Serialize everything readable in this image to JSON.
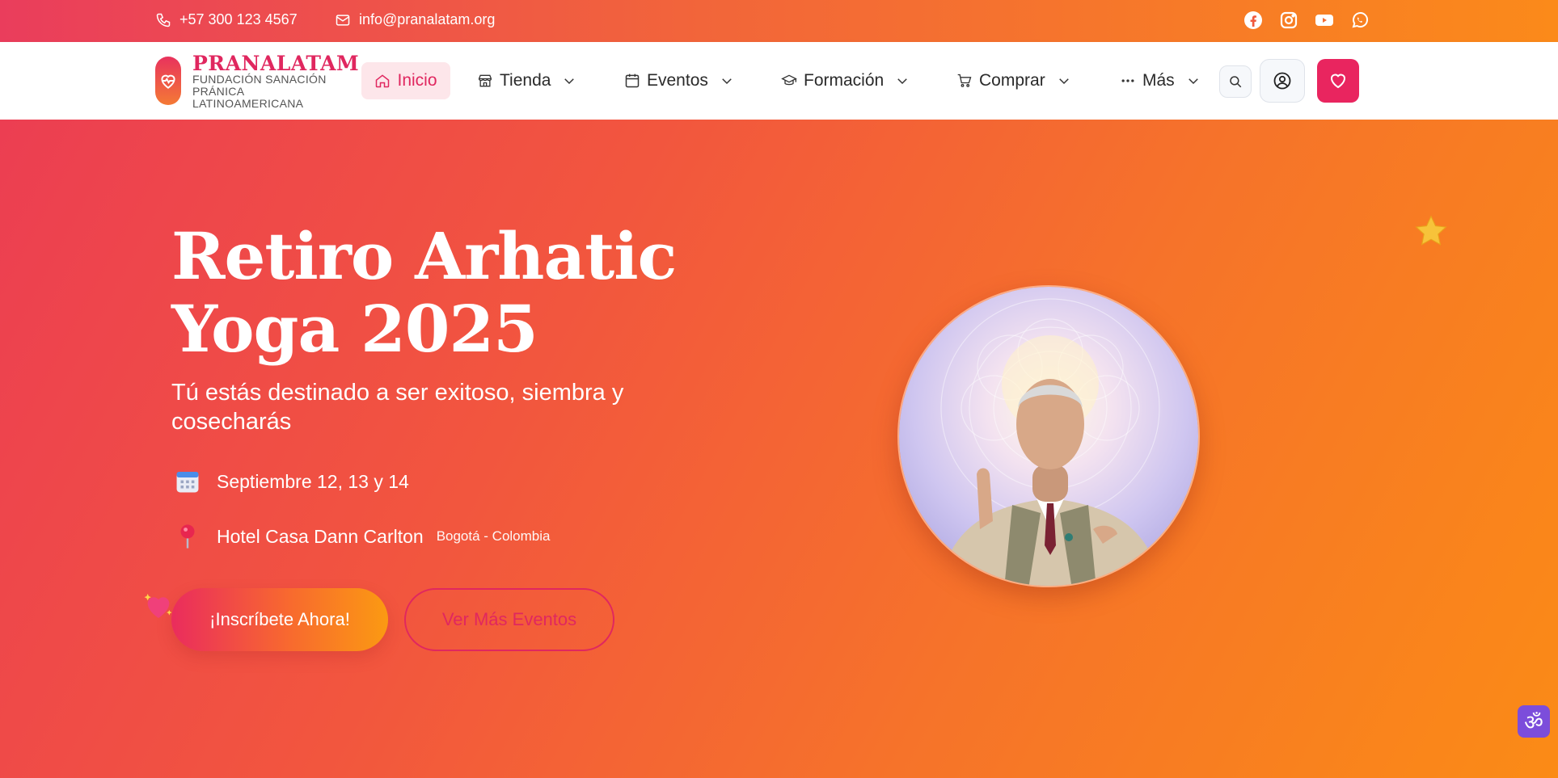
{
  "topbar": {
    "phone": "+57 300 123 4567",
    "email": "info@pranalatam.org",
    "socials": [
      "facebook-icon",
      "instagram-icon",
      "youtube-icon",
      "whatsapp-icon"
    ]
  },
  "brand": {
    "name": "PRANALATAM",
    "subtitle": "FUNDACIÓN SANACIÓN PRÁNICA LATINOAMERICANA",
    "primary_color": "#e0275f",
    "accent_color": "#fb8a1a"
  },
  "nav": {
    "items": [
      {
        "label": "Inicio",
        "icon": "home-icon",
        "active": true
      },
      {
        "label": "Tienda",
        "icon": "store-icon"
      },
      {
        "label": "Eventos",
        "icon": "calendar-icon"
      },
      {
        "label": "Formación",
        "icon": "graduation-cap-icon"
      },
      {
        "label": "Comprar",
        "icon": "cart-icon"
      },
      {
        "label": "Más",
        "icon": "more-dots-icon"
      }
    ]
  },
  "hero": {
    "title": "Retiro Arhatic Yoga 2025",
    "subtitle": "Tú estás destinado a ser exitoso, siembra y cosecharás",
    "date": "Septiembre 12, 13 y 14",
    "venue": "Hotel Casa Dann Carlton",
    "city": "Bogotá - Colombia",
    "cta_primary": "¡Inscríbete Ahora!",
    "cta_secondary": "Ver Más Eventos"
  },
  "floating_badge": "ॐ"
}
